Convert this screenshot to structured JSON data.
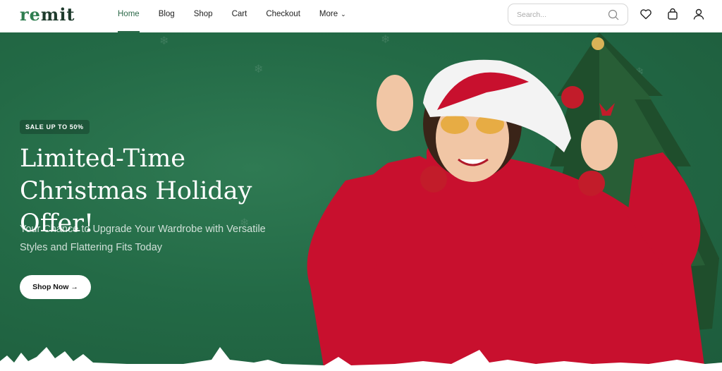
{
  "header": {
    "logo": {
      "prefix": "re",
      "rest": "mit"
    },
    "nav": [
      {
        "label": "Home",
        "active": true
      },
      {
        "label": "Blog"
      },
      {
        "label": "Shop"
      },
      {
        "label": "Cart"
      },
      {
        "label": "Checkout"
      },
      {
        "label": "More",
        "has_dropdown": true
      }
    ],
    "search": {
      "placeholder": "Search..."
    },
    "icons": [
      "search-icon",
      "heart-icon",
      "bag-icon",
      "user-icon"
    ]
  },
  "hero": {
    "badge": "SALE UP TO 50%",
    "headline_line1": "Limited-Time",
    "headline_line2": "Christmas Holiday Offer!",
    "subtitle_line1": "Your Chance to Upgrade Your Wardrobe with Versatile",
    "subtitle_line2": "Styles and Flattering Fits Today",
    "cta_label": "Shop Now →",
    "background_color": "#236a46",
    "accent_color": "#2e6a4a"
  }
}
